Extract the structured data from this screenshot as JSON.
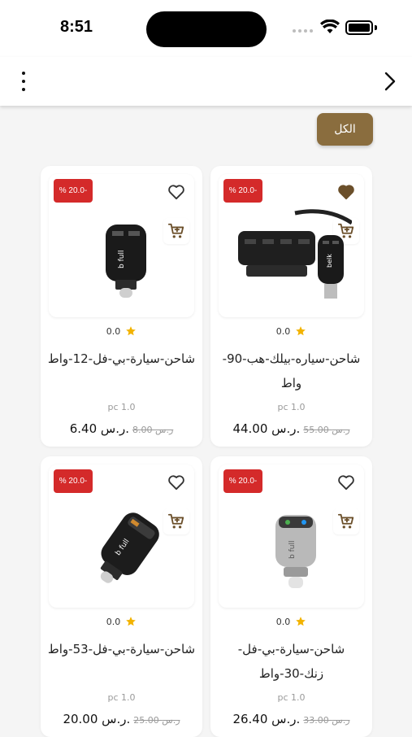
{
  "status_bar": {
    "time": "8:51"
  },
  "filter": {
    "label": "الكل"
  },
  "colors": {
    "accent": "#8a6d3e",
    "discount": "#d42a2a",
    "star": "#f2b300",
    "heart": "#6b4f2a"
  },
  "products": [
    {
      "name": "شاحن-سياره-بيلك-هب-90-واط",
      "discount": "% 20.0-",
      "rating": "0.0",
      "unit": "pc 1.0",
      "price": "44.00 ر.س.",
      "old_price": "55.00 ر.س",
      "favorite": true,
      "icon": "hub-charger-image"
    },
    {
      "name": "شاحن-سيارة-بي-فل-12-واط",
      "discount": "% 20.0-",
      "rating": "0.0",
      "unit": "pc 1.0",
      "price": "6.40 ر.س.",
      "old_price": "8.00 ر.س",
      "favorite": false,
      "icon": "car-charger-image"
    },
    {
      "name": "شاحن-سيارة-بي-فل-زنك-30-واط",
      "discount": "% 20.0-",
      "rating": "0.0",
      "unit": "pc 1.0",
      "price": "26.40 ر.س.",
      "old_price": "33.00 ر.س",
      "favorite": false,
      "icon": "silver-charger-image"
    },
    {
      "name": "شاحن-سيارة-بي-فل-53-واط",
      "discount": "% 20.0-",
      "rating": "0.0",
      "unit": "pc 1.0",
      "price": "20.00 ر.س.",
      "old_price": "25.00 ر.س",
      "favorite": false,
      "icon": "black-charger-image"
    }
  ]
}
